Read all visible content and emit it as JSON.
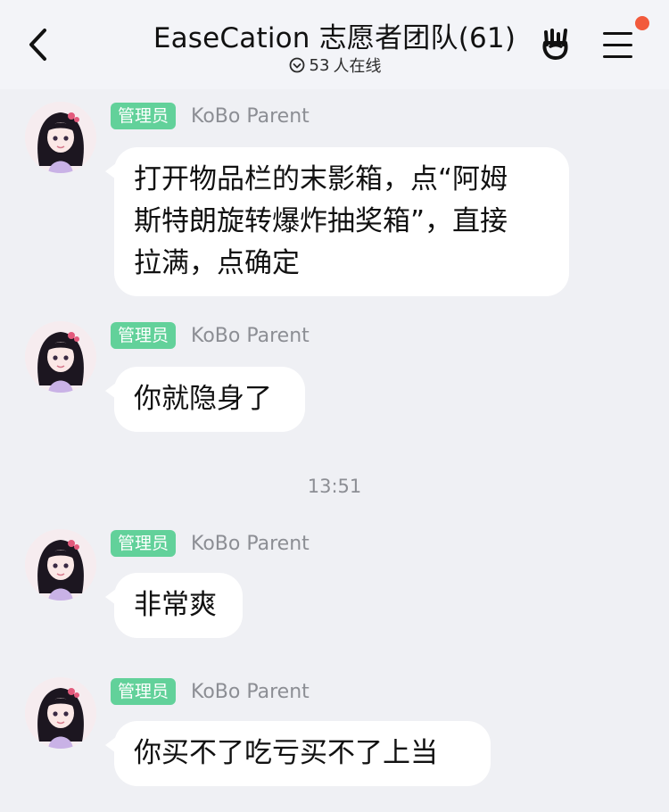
{
  "header": {
    "title": "EaseCation 志愿者团队(61)",
    "online_count": "53",
    "online_suffix": "人在线",
    "back_icon": "chevron-left-icon",
    "hand_icon": "rock-hand-icon",
    "menu_icon": "hamburger-menu-icon",
    "notification_dot_color": "#f25a3c"
  },
  "messages": [
    {
      "role": "管理员",
      "sender": "KoBo Parent",
      "lines": [
        "打开物品栏的末影箱，点“阿姆",
        "斯特朗旋转爆炸抽奖箱”，直接",
        "拉满，点确定"
      ]
    },
    {
      "role": "管理员",
      "sender": "KoBo Parent",
      "lines": [
        "你就隐身了"
      ]
    },
    {
      "role": "管理员",
      "sender": "KoBo Parent",
      "lines": [
        "非常爽"
      ]
    },
    {
      "role": "管理员",
      "sender": "KoBo Parent",
      "lines": [
        "你买不了吃亏买不了上当"
      ]
    }
  ],
  "time_separator": "13:51",
  "colors": {
    "badge_green": "#62d19a",
    "background": "#eff0f4",
    "bubble": "#ffffff",
    "muted_text": "#8c8e94"
  }
}
